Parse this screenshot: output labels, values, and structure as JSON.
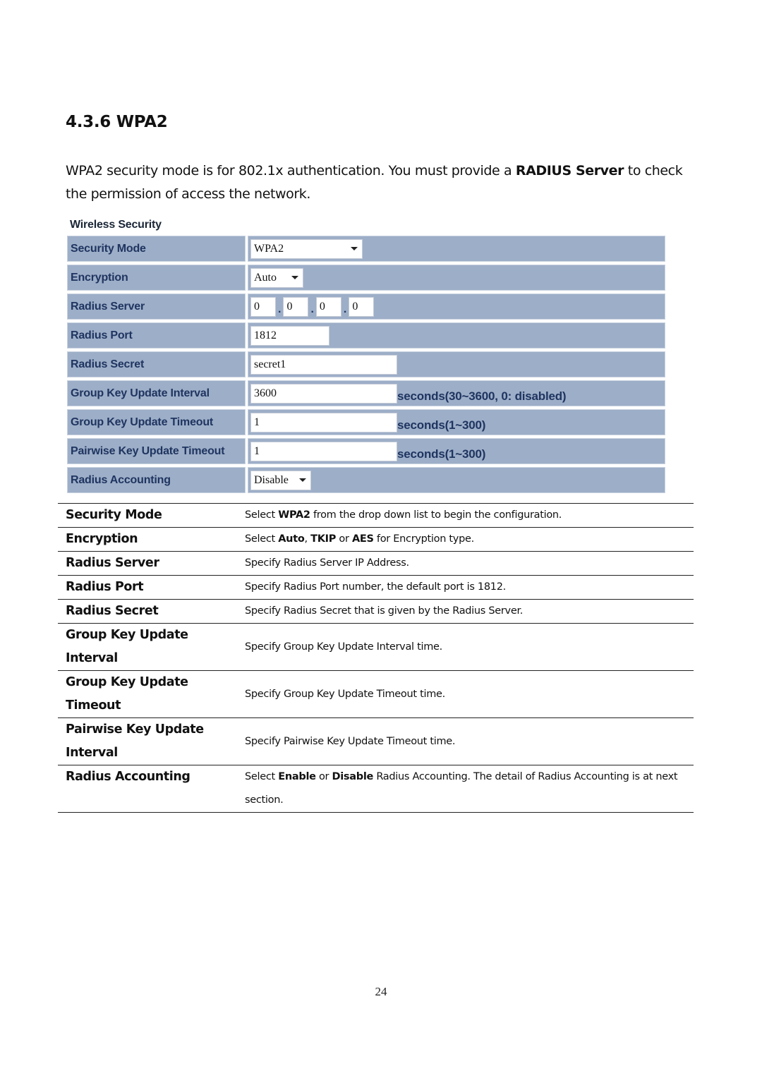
{
  "heading": "4.3.6 WPA2",
  "intro": {
    "before": "WPA2 security mode is for 802.1x authentication. You must provide a ",
    "bold": "RADIUS Server",
    "after": " to check the permission of access the network."
  },
  "panel": {
    "title": "Wireless Security",
    "rows": {
      "security_mode": {
        "label": "Security Mode",
        "value": "WPA2"
      },
      "encryption": {
        "label": "Encryption",
        "value": "Auto"
      },
      "radius_server": {
        "label": "Radius Server",
        "octets": [
          "0",
          "0",
          "0",
          "0"
        ],
        "separator": "."
      },
      "radius_port": {
        "label": "Radius Port",
        "value": "1812"
      },
      "radius_secret": {
        "label": "Radius Secret",
        "value": "secret1"
      },
      "group_key_interval": {
        "label": "Group Key Update Interval",
        "value": "3600",
        "hint": "seconds(30~3600, 0: disabled)"
      },
      "group_key_timeout": {
        "label": "Group Key Update Timeout",
        "value": "1",
        "hint": "seconds(1~300)"
      },
      "pairwise_key_timeout": {
        "label": "Pairwise Key Update Timeout",
        "value": "1",
        "hint": "seconds(1~300)"
      },
      "radius_accounting": {
        "label": "Radius Accounting",
        "value": "Disable"
      }
    }
  },
  "descriptions": [
    {
      "name": "Security Mode",
      "parts": [
        [
          "Select ",
          false
        ],
        [
          "WPA2",
          true
        ],
        [
          " from the drop down list to begin the configuration.",
          false
        ]
      ]
    },
    {
      "name": "Encryption",
      "parts": [
        [
          "Select ",
          false
        ],
        [
          "Auto",
          true
        ],
        [
          ", ",
          false
        ],
        [
          "TKIP",
          true
        ],
        [
          " or ",
          false
        ],
        [
          "AES",
          true
        ],
        [
          " for Encryption type.",
          false
        ]
      ]
    },
    {
      "name": "Radius Server",
      "parts": [
        [
          "Specify Radius Server IP Address.",
          false
        ]
      ]
    },
    {
      "name": "Radius Port",
      "parts": [
        [
          "Specify Radius Port number, the default port is 1812.",
          false
        ]
      ]
    },
    {
      "name": "Radius Secret",
      "parts": [
        [
          "Specify Radius Secret that is given by the Radius Server.",
          false
        ]
      ]
    },
    {
      "name": "Group Key Update Interval",
      "parts": [
        [
          "Specify Group Key Update Interval time.",
          false
        ]
      ]
    },
    {
      "name": "Group Key Update Timeout",
      "parts": [
        [
          "Specify Group Key Update Timeout time.",
          false
        ]
      ]
    },
    {
      "name": "Pairwise Key Update Interval",
      "parts": [
        [
          "Specify Pairwise Key Update Timeout time.",
          false
        ]
      ]
    },
    {
      "name": "Radius Accounting",
      "parts": [
        [
          "Select ",
          false
        ],
        [
          "Enable",
          true
        ],
        [
          " or ",
          false
        ],
        [
          "Disable",
          true
        ],
        [
          " Radius Accounting. The detail of Radius Accounting is at next section.",
          false
        ]
      ]
    }
  ],
  "page_number": "24"
}
